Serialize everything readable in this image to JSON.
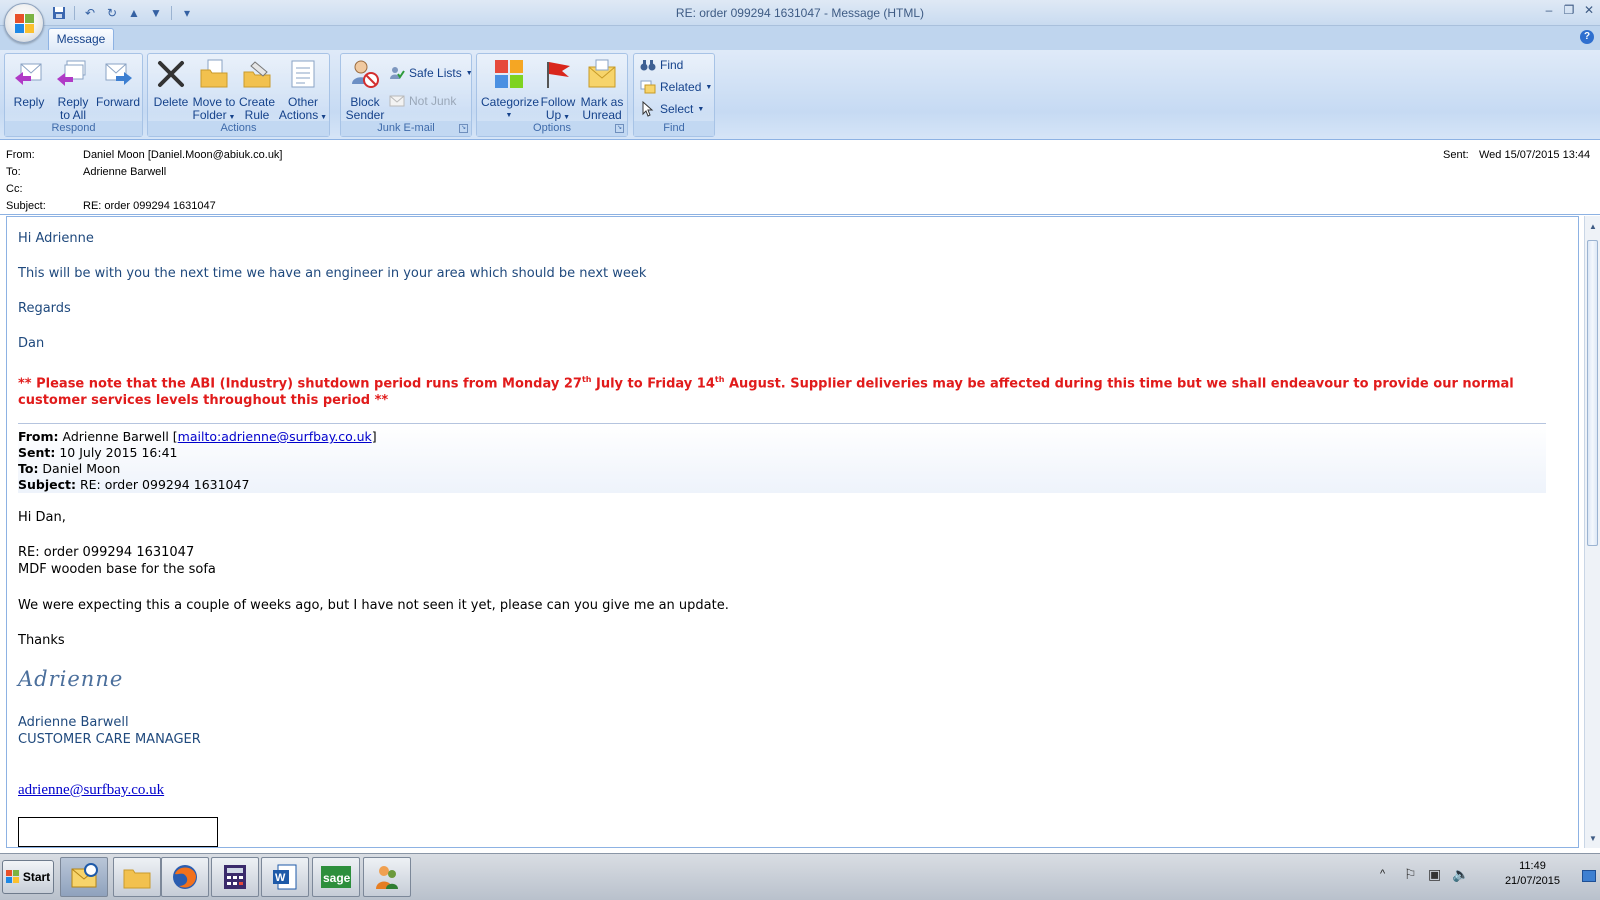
{
  "window": {
    "title": "RE: order 099294  1631047 - Message (HTML)"
  },
  "ribbon": {
    "tab_message": "Message",
    "groups": {
      "respond": "Respond",
      "actions": "Actions",
      "junk": "Junk E-mail",
      "options": "Options",
      "find": "Find"
    },
    "buttons": {
      "reply": "Reply",
      "reply_all_1": "Reply",
      "reply_all_2": "to All",
      "forward": "Forward",
      "delete": "Delete",
      "move_1": "Move to",
      "move_2": "Folder",
      "create_1": "Create",
      "create_2": "Rule",
      "other_1": "Other",
      "other_2": "Actions",
      "block_1": "Block",
      "block_2": "Sender",
      "safe_lists": "Safe Lists",
      "not_junk": "Not Junk",
      "categorize": "Categorize",
      "follow_1": "Follow",
      "follow_2": "Up",
      "mark_1": "Mark as",
      "mark_2": "Unread",
      "find": "Find",
      "related": "Related",
      "select": "Select"
    }
  },
  "header": {
    "from_label": "From:",
    "from_value": "Daniel Moon [Daniel.Moon@abiuk.co.uk]",
    "to_label": "To:",
    "to_value": "Adrienne Barwell",
    "cc_label": "Cc:",
    "subject_label": "Subject:",
    "subject_value": "RE: order 099294  1631047",
    "sent_label": "Sent:",
    "sent_value": "Wed 15/07/2015 13:44"
  },
  "message": {
    "greeting": "Hi Adrienne",
    "line1": "This will be with you the next time we have an engineer in your area which should be next week",
    "regards": "Regards",
    "name": "Dan",
    "notice_a": "** Please note that the ABI (Industry) shutdown period runs from Monday 27",
    "notice_sup1": "th",
    "notice_b": " July to Friday 14",
    "notice_sup2": "th",
    "notice_c": " August.  Supplier deliveries may be affected during this time but we shall endeavour to provide our normal customer services levels throughout this period **",
    "fwd": {
      "from_label": "From:",
      "from_value": " Adrienne Barwell [",
      "from_link": "mailto:adrienne@surfbay.co.uk",
      "from_close": "]",
      "sent_label": "Sent:",
      "sent_value": " 10 July 2015 16:41",
      "to_label": "To:",
      "to_value": " Daniel Moon",
      "subject_label": "Subject:",
      "subject_value": " RE: order 099294 1631047"
    },
    "hi_dan": "Hi Dan,",
    "re_order": "RE: order 099294  1631047",
    "mdf": "MDF wooden base for the sofa",
    "expecting": "We were expecting this a couple of weeks ago, but I have not seen it yet, please can you give me an update.",
    "thanks": "Thanks",
    "signature": "Adrienne",
    "sig_name": "Adrienne Barwell",
    "sig_title": "CUSTOMER CARE MANAGER",
    "sig_email": "adrienne@surfbay.co.uk"
  },
  "taskbar": {
    "start": "Start",
    "time": "11:49",
    "date": "21/07/2015"
  }
}
